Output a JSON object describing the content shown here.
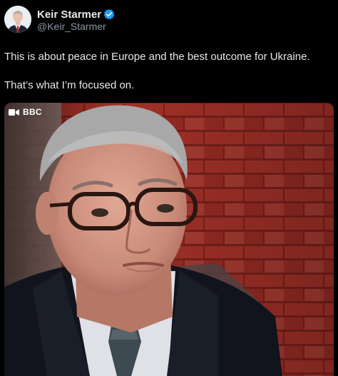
{
  "post": {
    "author": {
      "display_name": "Keir Starmer",
      "handle": "@Keir_Starmer",
      "verified": true,
      "verified_icon": "verified-badge-icon",
      "avatar_icon": "profile-photo"
    },
    "text": {
      "line1": "This is about peace in Europe and the best outcome for Ukraine.",
      "line2": "That’s what I’m focused on."
    },
    "media": {
      "type": "video",
      "broadcaster_label": "BBC",
      "broadcaster_icon": "video-camera-icon"
    }
  },
  "colors": {
    "background": "#000000",
    "text_primary": "#e7e9ea",
    "text_secondary": "#8b98a5",
    "verified_blue": "#1d9bf0",
    "brick_red": "#b5362d"
  }
}
